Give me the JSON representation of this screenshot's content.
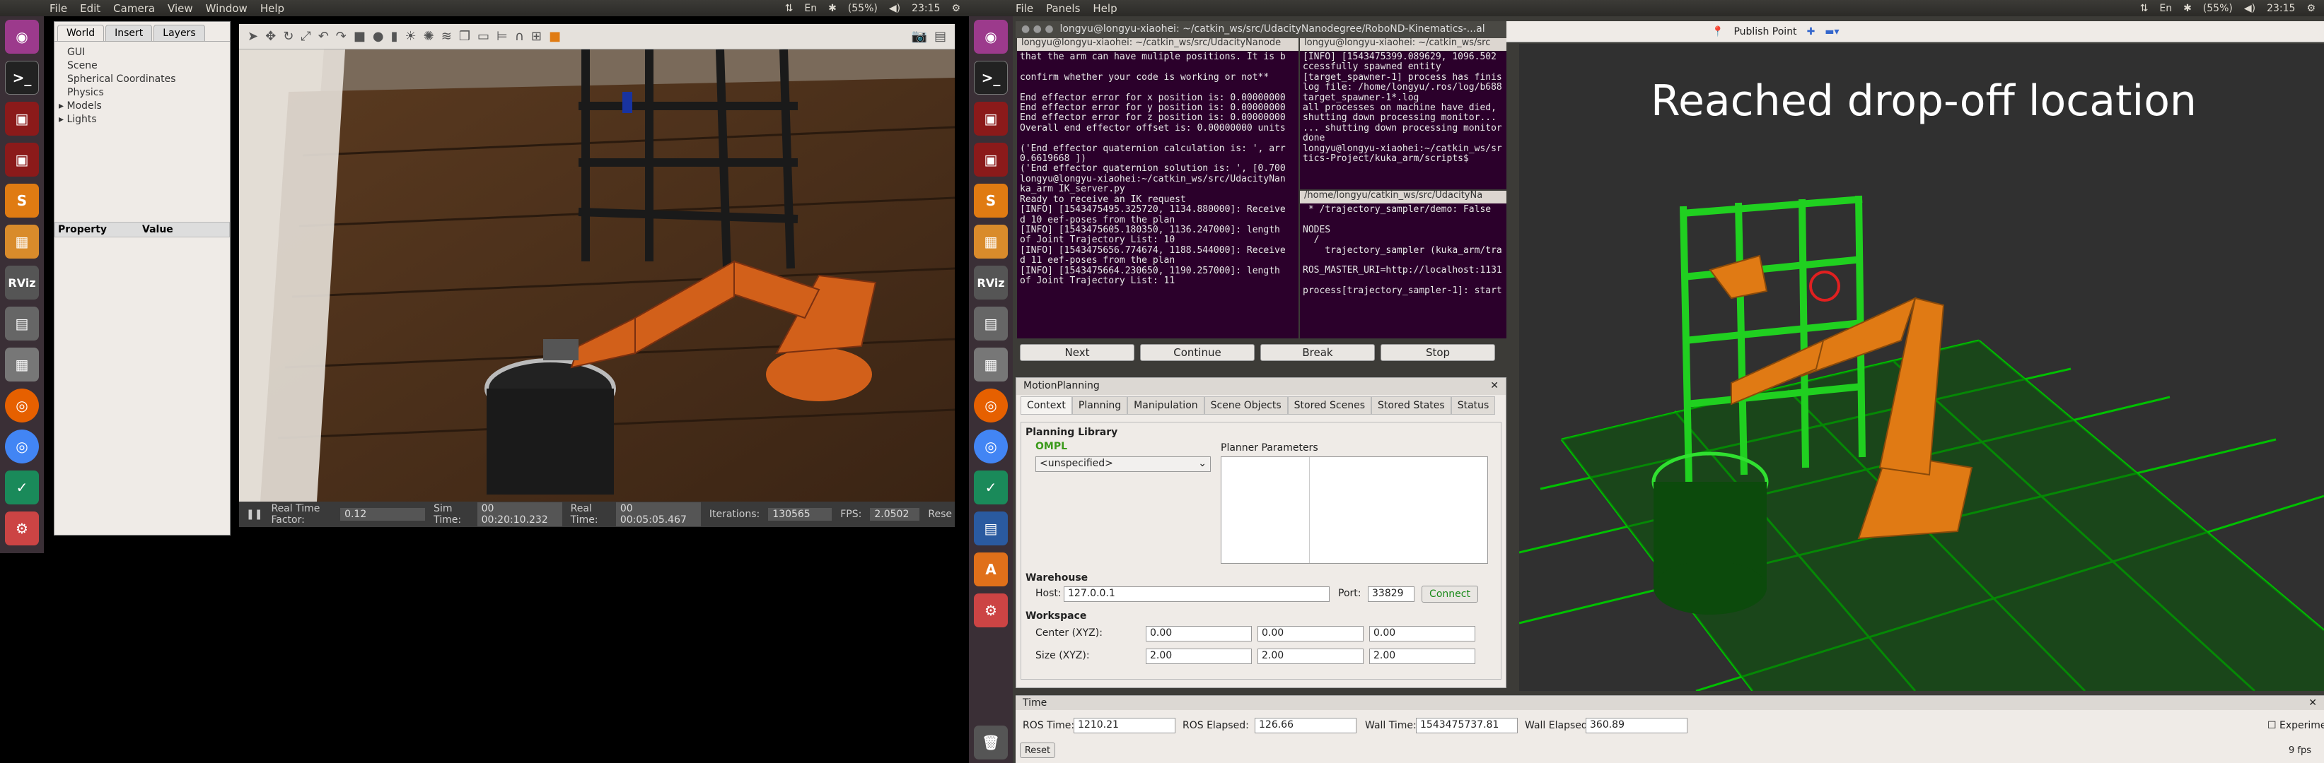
{
  "screen1": {
    "menu": [
      "File",
      "Edit",
      "Camera",
      "View",
      "Window",
      "Help"
    ],
    "tray": {
      "battery": "(55%)",
      "volume": "◀)",
      "clock": "23:15",
      "kbd": "En"
    },
    "tabs": [
      "World",
      "Insert",
      "Layers"
    ],
    "world_tree": [
      "GUI",
      "Scene",
      "Spherical Coordinates",
      "Physics",
      "Models",
      "Lights"
    ],
    "prop_headers": [
      "Property",
      "Value"
    ],
    "status": {
      "rtf_label": "Real Time Factor:",
      "rtf": "0.12",
      "sim_label": "Sim Time:",
      "sim": "00 00:20:10.232",
      "real_label": "Real Time:",
      "real": "00 00:05:05.467",
      "iter_label": "Iterations:",
      "iter": "130565",
      "fps_label": "FPS:",
      "fps": "2.0502",
      "reset": "Rese"
    }
  },
  "screen2": {
    "menu": [
      "File",
      "Panels",
      "Help"
    ],
    "tray": {
      "battery": "(55%)",
      "clock": "23:15",
      "kbd": "En"
    },
    "terminal_main_title": "longyu@longyu-xiaohei: ~/catkin_ws/src/UdacityNanodegree/RoboND-Kinematics-...al",
    "term1_title": "longyu@longyu-xiaohei: ~/catkin_ws/src/UdacityNanode",
    "term1_lines": [
      "that the arm can have muliple positions. It is b",
      "",
      "confirm whether your code is working or not**",
      "",
      "End effector error for x position is: 0.00000000",
      "End effector error for y position is: 0.00000000",
      "End effector error for z position is: 0.00000000",
      "Overall end effector offset is: 0.00000000 units",
      "",
      "('End effector quaternion calculation is: ', arr",
      "0.6619668 ])",
      "('End effector quaternion solution is: ', [0.700",
      "longyu@longyu-xiaohei:~/catkin_ws/src/UdacityNan",
      "ka_arm IK_server.py",
      "Ready to receive an IK request",
      "[INFO] [1543475495.325720, 1134.880000]: Receive",
      "d 10 eef-poses from the plan",
      "[INFO] [1543475605.180350, 1136.247000]: length",
      "of Joint Trajectory List: 10",
      "[INFO] [1543475656.774674, 1188.544000]: Receive",
      "d 11 eef-poses from the plan",
      "[INFO] [1543475664.230650, 1190.257000]: length",
      "of Joint Trajectory List: 11",
      ""
    ],
    "term2_title": "longyu@longyu-xiaohei: ~/catkin_ws/src",
    "term2_lines": [
      "[INFO] [1543475399.089629, 1096.502",
      "ccessfully spawned entity",
      "[target_spawner-1] process has finis",
      "log file: /home/longyu/.ros/log/b688",
      "target_spawner-1*.log",
      "all processes on machine have died,",
      "shutting down processing monitor...",
      "... shutting down processing monitor",
      "done",
      "longyu@longyu-xiaohei:~/catkin_ws/sr",
      "tics-Project/kuka_arm/scripts$ "
    ],
    "term3_title": "/home/longyu/catkin_ws/src/UdacityNa",
    "term3_lines": [
      " * /trajectory_sampler/demo: False",
      "",
      "NODES",
      "  /",
      "    trajectory_sampler (kuka_arm/tra",
      "",
      "ROS_MASTER_URI=http://localhost:1131",
      "",
      "process[trajectory_sampler-1]: start"
    ],
    "rviz_toolbar": [
      "Publish Point"
    ],
    "buttons": [
      "Next",
      "Continue",
      "Break",
      "Stop"
    ],
    "mp_title": "MotionPlanning",
    "mp_tabs": [
      "Context",
      "Planning",
      "Manipulation",
      "Scene Objects",
      "Stored Scenes",
      "Stored States",
      "Status"
    ],
    "planning_library": "Planning Library",
    "ompl": "OMPL",
    "planner": "<unspecified>",
    "planner_params": "Planner Parameters",
    "warehouse": "Warehouse",
    "host_label": "Host:",
    "host": "127.0.0.1",
    "port_label": "Port:",
    "port": "33829",
    "connect": "Connect",
    "workspace": "Workspace",
    "center_label": "Center (XYZ):",
    "center": [
      "0.00",
      "0.00",
      "0.00"
    ],
    "size_label": "Size (XYZ):",
    "size": [
      "2.00",
      "2.00",
      "2.00"
    ],
    "banner": "Reached  drop-off  location",
    "time_title": "Time",
    "ros_time_label": "ROS Time:",
    "ros_time": "1210.21",
    "ros_elapsed_label": "ROS Elapsed:",
    "ros_elapsed": "126.66",
    "wall_time_label": "Wall Time:",
    "wall_time": "1543475737.81",
    "wall_elapsed_label": "Wall Elapsed:",
    "wall_elapsed": "360.89",
    "experimental": "Experimental",
    "reset": "Reset",
    "fps": "9 fps"
  },
  "colors": {
    "launcher": "#3a2f36",
    "terminal_bg": "#2b002b",
    "rviz_bg": "#303030",
    "grid": "#00c000"
  }
}
